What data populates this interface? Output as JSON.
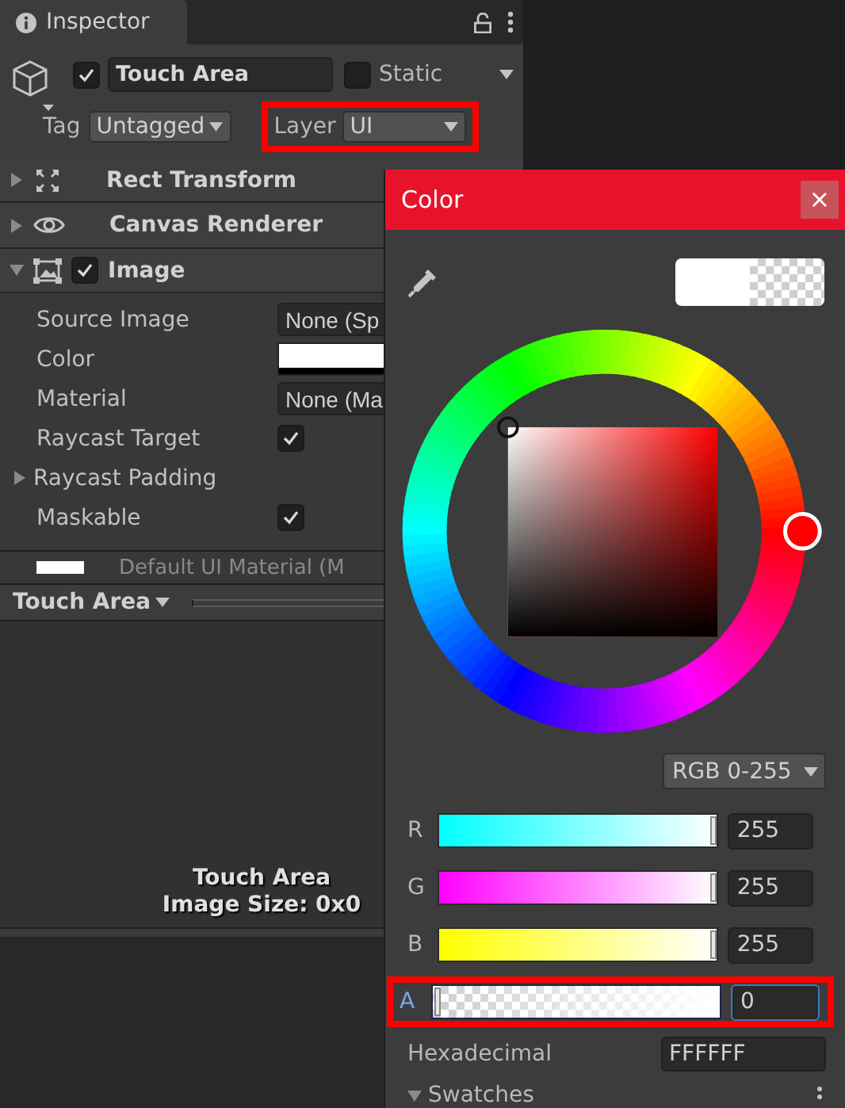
{
  "inspector": {
    "tab": "Inspector",
    "object": {
      "active": true,
      "name": "Touch Area",
      "static": false,
      "static_label": "Static",
      "tag_label": "Tag",
      "tag": "Untagged",
      "layer_label": "Layer",
      "layer": "UI",
      "layer_highlighted": true
    },
    "components": [
      {
        "name": "Rect Transform",
        "kind": "rect",
        "expanded": false
      },
      {
        "name": "Canvas Renderer",
        "kind": "eye",
        "expanded": false
      },
      {
        "name": "Image",
        "kind": "image",
        "expanded": true,
        "enabled": true
      }
    ],
    "properties": [
      {
        "label": "Source Image",
        "kind": "object",
        "value": "None (Sp"
      },
      {
        "label": "Color",
        "kind": "color"
      },
      {
        "label": "Material",
        "kind": "object",
        "value": "None (Ma"
      },
      {
        "label": "Raycast Target",
        "kind": "toggle",
        "checked": true
      },
      {
        "label": "Raycast Padding",
        "kind": "foldout",
        "expanded": false
      },
      {
        "label": "Maskable",
        "kind": "toggle",
        "checked": true
      }
    ],
    "material_preview": "Default UI Material (M",
    "preview": {
      "title": "Touch Area",
      "caption_name": "Touch Area",
      "caption_size": "Image Size: 0x0"
    }
  },
  "color_picker": {
    "title": "Color",
    "close": "×",
    "mode": "RGB 0-255",
    "channels": [
      {
        "label": "R",
        "kind": "rgb",
        "level": 1,
        "value": "255",
        "focused": false,
        "highlighted": false
      },
      {
        "label": "G",
        "kind": "rgb",
        "level": 1,
        "value": "255",
        "focused": false,
        "highlighted": false
      },
      {
        "label": "B",
        "kind": "rgb",
        "level": 1,
        "value": "255",
        "focused": false,
        "highlighted": false
      },
      {
        "label": "A",
        "kind": "alpha",
        "level": 0,
        "value": "0",
        "focused": true,
        "highlighted": true
      }
    ],
    "hex_label": "Hexadecimal",
    "hex": "FFFFFF",
    "swatches": "Swatches",
    "swatches_expanded": true
  }
}
